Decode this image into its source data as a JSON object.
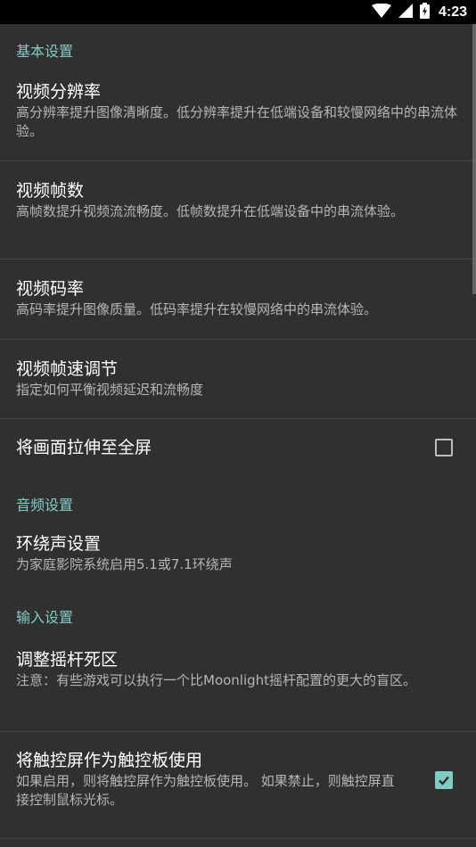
{
  "status_bar": {
    "time": "4:23",
    "icons": [
      "wifi-icon",
      "cellular-signal-icon",
      "battery-charging-icon"
    ]
  },
  "sections": {
    "basic": {
      "header": "基本设置",
      "resolution": {
        "title": "视频分辨率",
        "summary": "高分辨率提升图像清晰度。低分辨率提升在低端设备和较慢网络中的串流体验。"
      },
      "fps": {
        "title": "视频帧数",
        "summary": "高帧数提升视频流流畅度。低帧数提升在低端设备中的串流体验。"
      },
      "bitrate": {
        "title": "视频码率",
        "summary": "高码率提升图像质量。低码率提升在较慢网络中的串流体验。"
      },
      "frame_pacing": {
        "title": "视频帧速调节",
        "summary": "指定如何平衡视频延迟和流畅度"
      },
      "stretch": {
        "title": "将画面拉伸至全屏",
        "checked": false
      }
    },
    "audio": {
      "header": "音频设置",
      "surround": {
        "title": "环绕声设置",
        "summary": "为家庭影院系统启用5.1或7.1环绕声"
      }
    },
    "input": {
      "header": "输入设置",
      "deadzone": {
        "title": "调整摇杆死区",
        "summary": "注意：有些游戏可以执行一个比Moonlight摇杆配置的更大的盲区。"
      },
      "touchpad": {
        "title": "将触控屏作为触控板使用",
        "summary": "如果启用，则将触控屏作为触控板使用。 如果禁止，则触控屏直接控制鼠标光标。",
        "checked": true
      }
    }
  },
  "colors": {
    "accent": "#80cbc4",
    "background": "#303030",
    "status_bar": "#000000",
    "title_text": "#ffffff",
    "summary_text": "#b6b6b6"
  }
}
